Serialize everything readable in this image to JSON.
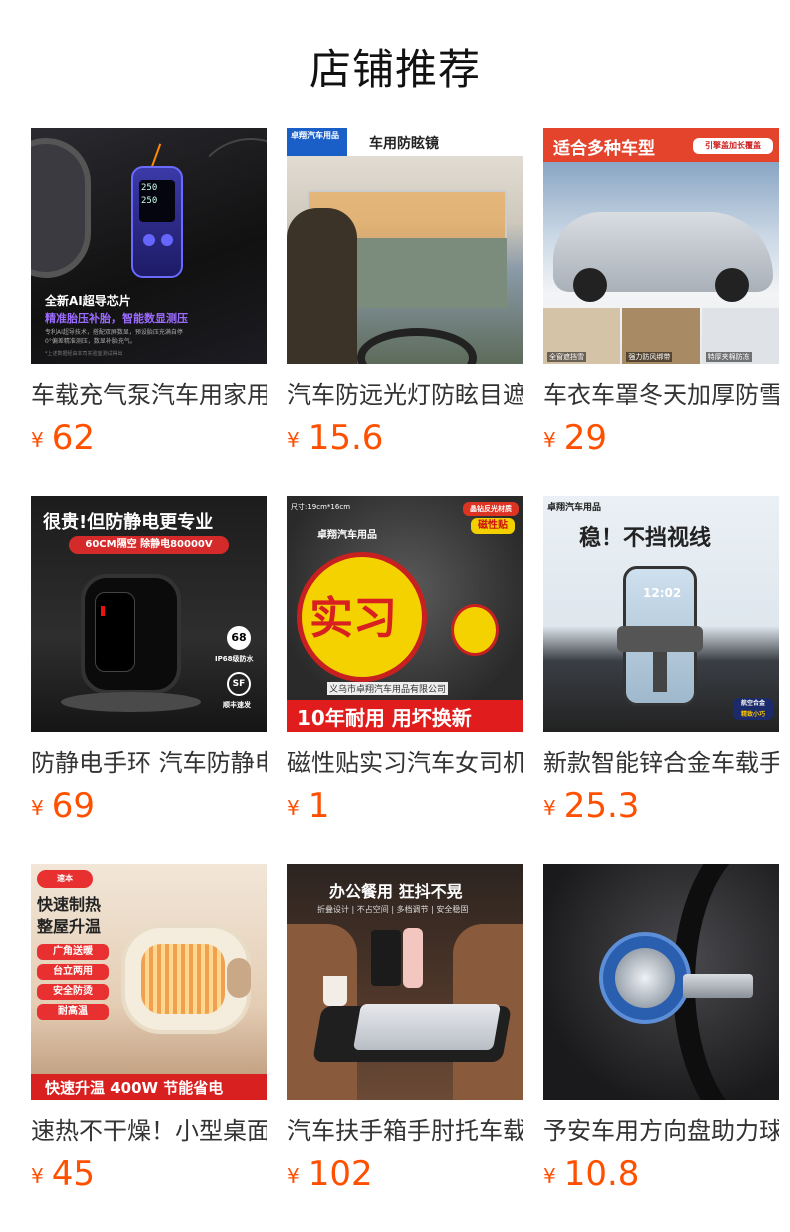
{
  "page": {
    "title": "店铺推荐"
  },
  "products": [
    {
      "name": "车载充气泵汽车用家用高压",
      "price": "62",
      "currency": "¥",
      "image": {
        "texts": [
          "全新AI超导芯片",
          "精准胎压补胎，智能数显测压",
          "专利AI超导技术，搭配双屏数显，预设胎压充满自停",
          "0°偏差精准测压，数显补胎充气。",
          "*上述数据经由本司实验室测试得出"
        ],
        "screen": [
          "250",
          "250"
        ]
      }
    },
    {
      "name": "汽车防远光灯防眩目遮阳板",
      "price": "15.6",
      "currency": "¥",
      "image": {
        "texts": [
          "卓翔汽车用品",
          "车用防眩镜"
        ]
      }
    },
    {
      "name": "车衣车罩冬天加厚防雪",
      "price": "29",
      "currency": "¥",
      "image": {
        "texts": [
          "适合多种车型",
          "引擎盖加长覆盖",
          "全窗遮挡雪",
          "强力防风绑带",
          "特厚夹棉防冻"
        ]
      }
    },
    {
      "name": "防静电手环 汽车防静电",
      "price": "69",
      "currency": "¥",
      "image": {
        "texts": [
          "很贵!但防静电更专业",
          "60CM隔空 除静电80000V",
          "68",
          "IP68级防水",
          "顺丰速发"
        ]
      }
    },
    {
      "name": "磁性贴实习汽车女司机",
      "price": "1",
      "currency": "¥",
      "image": {
        "texts": [
          "尺寸:19cm*16cm",
          "卓翔汽车用品",
          "晶钻反光材质",
          "磁性贴",
          "实习",
          "义乌市卓翔汽车用品有限公司",
          "10年耐用 用坏换新"
        ]
      }
    },
    {
      "name": "新款智能锌合金车载手机支架",
      "price": "25.3",
      "currency": "¥",
      "image": {
        "texts": [
          "卓翔汽车用品",
          "稳！不挡视线",
          "12:02",
          "航空合金",
          "精致小巧"
        ]
      }
    },
    {
      "name": "速热不干燥！小型桌面暖风机",
      "price": "45",
      "currency": "¥",
      "image": {
        "texts": [
          "速本",
          "快速制热",
          "整屋升温",
          "广角送暖",
          "台立两用",
          "安全防烫",
          "耐高温",
          "快速升温 400W 节能省电"
        ]
      }
    },
    {
      "name": "汽车扶手箱手肘托车载小桌板",
      "price": "102",
      "currency": "¥",
      "image": {
        "texts": [
          "办公餐用 狂抖不晃",
          "折叠设计 | 不占空间 | 多档调节 | 安全稳固"
        ]
      }
    },
    {
      "name": "予安车用方向盘助力球",
      "price": "10.8",
      "currency": "¥",
      "image": {
        "texts": []
      }
    }
  ]
}
